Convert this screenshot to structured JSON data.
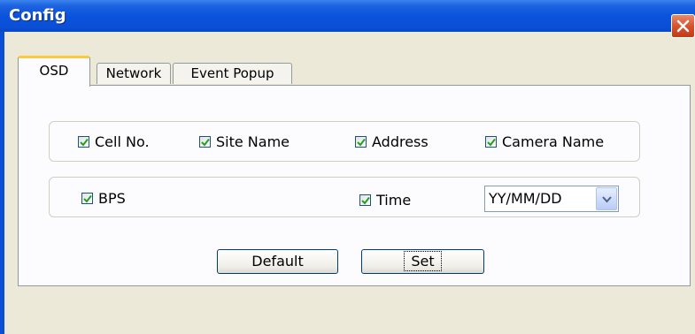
{
  "window": {
    "title": "Config",
    "close_label": "×"
  },
  "tabs": [
    {
      "label": "OSD",
      "active": true
    },
    {
      "label": "Network",
      "active": false
    },
    {
      "label": "Event Popup",
      "active": false
    }
  ],
  "osd": {
    "row1": [
      {
        "label": "Cell No.",
        "checked": true
      },
      {
        "label": "Site Name",
        "checked": true
      },
      {
        "label": "Address",
        "checked": true
      },
      {
        "label": "Camera Name",
        "checked": true
      }
    ],
    "row2": [
      {
        "label": "BPS",
        "checked": true
      },
      {
        "label": "Time",
        "checked": true
      }
    ],
    "date_format": {
      "selected": "YY/MM/DD"
    }
  },
  "buttons": {
    "default_label": "Default",
    "set_label": "Set"
  },
  "colors": {
    "titlebar": "#0a4fd6",
    "tab_highlight": "#ffc83c",
    "check": "#21a121"
  }
}
